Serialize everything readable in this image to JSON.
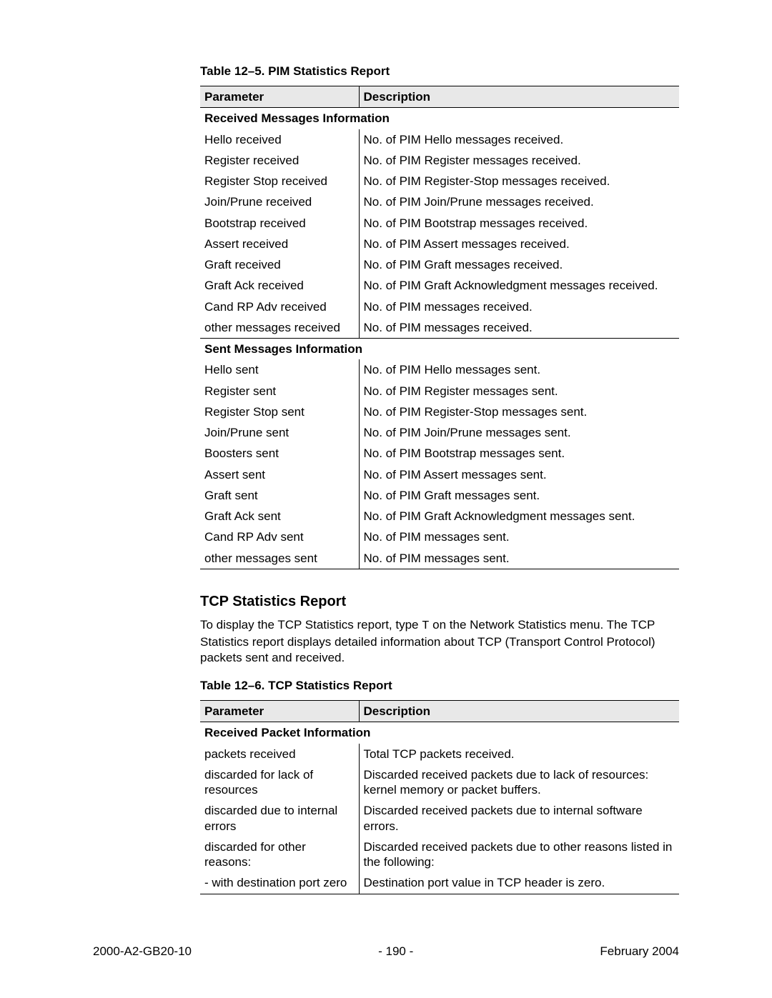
{
  "table1": {
    "caption": "Table 12–5.  PIM Statistics Report",
    "headers": {
      "param": "Parameter",
      "desc": "Description"
    },
    "section1": "Received Messages Information",
    "rows1": [
      {
        "p": "Hello received",
        "d": "No. of PIM Hello messages received."
      },
      {
        "p": "Register received",
        "d": "No. of PIM Register messages received."
      },
      {
        "p": "Register Stop received",
        "d": "No. of PIM Register-Stop messages received."
      },
      {
        "p": "Join/Prune received",
        "d": "No. of PIM Join/Prune messages received."
      },
      {
        "p": "Bootstrap received",
        "d": "No. of PIM Bootstrap messages received."
      },
      {
        "p": "Assert received",
        "d": "No. of PIM Assert messages received."
      },
      {
        "p": "Graft received",
        "d": "No. of PIM Graft messages received."
      },
      {
        "p": "Graft Ack received",
        "d": "No. of PIM Graft Acknowledgment messages received."
      },
      {
        "p": "Cand RP Adv received",
        "d": "No. of PIM messages received."
      },
      {
        "p": "other messages received",
        "d": "No. of PIM messages received."
      }
    ],
    "section2": "Sent Messages Information",
    "rows2": [
      {
        "p": "Hello sent",
        "d": "No. of PIM Hello messages sent."
      },
      {
        "p": "Register sent",
        "d": "No. of PIM Register messages sent."
      },
      {
        "p": "Register Stop sent",
        "d": "No. of PIM Register-Stop messages sent."
      },
      {
        "p": "Join/Prune sent",
        "d": "No. of PIM Join/Prune messages sent."
      },
      {
        "p": "Boosters sent",
        "d": "No. of PIM Bootstrap messages sent."
      },
      {
        "p": "Assert sent",
        "d": "No. of PIM Assert messages sent."
      },
      {
        "p": "Graft sent",
        "d": "No. of PIM Graft messages sent."
      },
      {
        "p": "Graft Ack sent",
        "d": "No. of PIM Graft Acknowledgment messages sent."
      },
      {
        "p": "Cand RP Adv sent",
        "d": "No. of PIM messages sent."
      },
      {
        "p": "other messages sent",
        "d": "No. of PIM messages sent."
      }
    ]
  },
  "section2": {
    "heading": "TCP Statistics Report",
    "para_pre": "To display the TCP Statistics report, type ",
    "para_code": "T",
    "para_post": " on the Network Statistics menu. The TCP Statistics report displays detailed information about TCP (Transport Control Protocol) packets sent and received."
  },
  "table2": {
    "caption": "Table 12–6.  TCP Statistics Report",
    "headers": {
      "param": "Parameter",
      "desc": "Description"
    },
    "section1": "Received Packet Information",
    "rows1": [
      {
        "p": "packets received",
        "d": "Total TCP packets received."
      },
      {
        "p": "discarded for lack of resources",
        "d": "Discarded received packets due to lack of resources: kernel memory or packet buffers."
      },
      {
        "p": "discarded due to internal errors",
        "d": "Discarded received packets due to internal software errors."
      },
      {
        "p": "discarded for other reasons:",
        "d": "Discarded received packets due to other reasons listed in the following:"
      },
      {
        "p": "- with destination port zero",
        "d": "Destination port value in TCP header is zero."
      }
    ]
  },
  "footer": {
    "left": "2000-A2-GB20-10",
    "center": "- 190 -",
    "right": "February 2004"
  }
}
